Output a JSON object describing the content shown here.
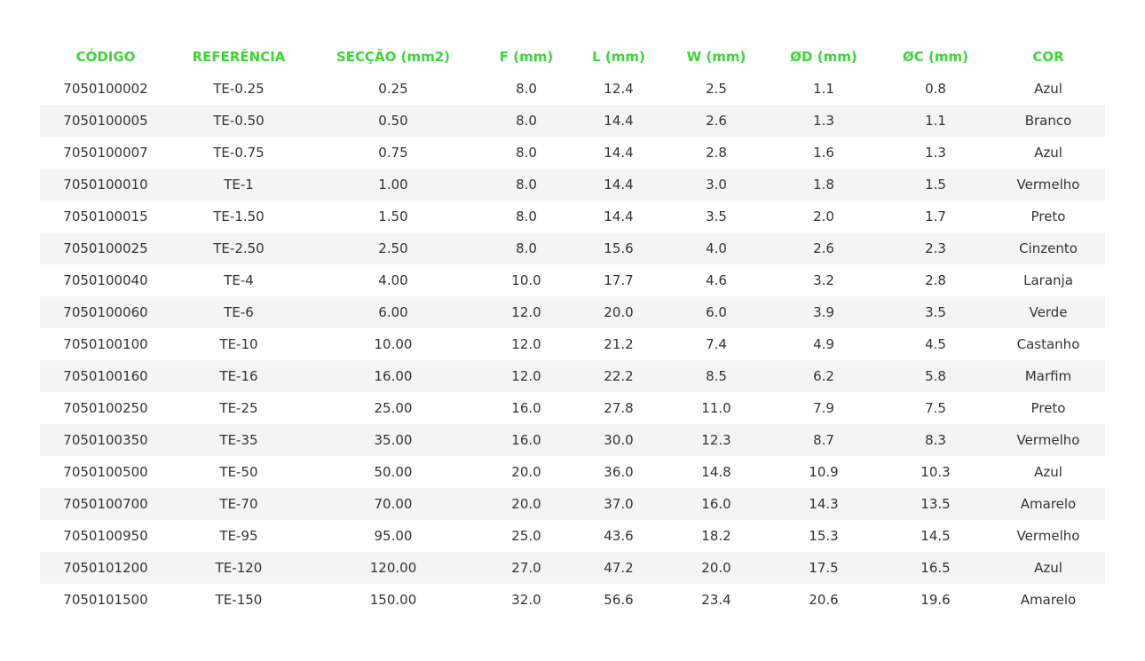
{
  "colors": {
    "accent": "#3fd43a",
    "text": "#333333",
    "row_alt": "#f4f4f4"
  },
  "table": {
    "headers": [
      "CÓDIGO",
      "REFERÊNCIA",
      "SECÇÃO (mm2)",
      "F (mm)",
      "L (mm)",
      "W (mm)",
      "ØD (mm)",
      "ØC (mm)",
      "COR"
    ],
    "rows": [
      [
        "7050100002",
        "TE-0.25",
        "0.25",
        "8.0",
        "12.4",
        "2.5",
        "1.1",
        "0.8",
        "Azul"
      ],
      [
        "7050100005",
        "TE-0.50",
        "0.50",
        "8.0",
        "14.4",
        "2.6",
        "1.3",
        "1.1",
        "Branco"
      ],
      [
        "7050100007",
        "TE-0.75",
        "0.75",
        "8.0",
        "14.4",
        "2.8",
        "1.6",
        "1.3",
        "Azul"
      ],
      [
        "7050100010",
        "TE-1",
        "1.00",
        "8.0",
        "14.4",
        "3.0",
        "1.8",
        "1.5",
        "Vermelho"
      ],
      [
        "7050100015",
        "TE-1.50",
        "1.50",
        "8.0",
        "14.4",
        "3.5",
        "2.0",
        "1.7",
        "Preto"
      ],
      [
        "7050100025",
        "TE-2.50",
        "2.50",
        "8.0",
        "15.6",
        "4.0",
        "2.6",
        "2.3",
        "Cinzento"
      ],
      [
        "7050100040",
        "TE-4",
        "4.00",
        "10.0",
        "17.7",
        "4.6",
        "3.2",
        "2.8",
        "Laranja"
      ],
      [
        "7050100060",
        "TE-6",
        "6.00",
        "12.0",
        "20.0",
        "6.0",
        "3.9",
        "3.5",
        "Verde"
      ],
      [
        "7050100100",
        "TE-10",
        "10.00",
        "12.0",
        "21.2",
        "7.4",
        "4.9",
        "4.5",
        "Castanho"
      ],
      [
        "7050100160",
        "TE-16",
        "16.00",
        "12.0",
        "22.2",
        "8.5",
        "6.2",
        "5.8",
        "Marfim"
      ],
      [
        "7050100250",
        "TE-25",
        "25.00",
        "16.0",
        "27.8",
        "11.0",
        "7.9",
        "7.5",
        "Preto"
      ],
      [
        "7050100350",
        "TE-35",
        "35.00",
        "16.0",
        "30.0",
        "12.3",
        "8.7",
        "8.3",
        "Vermelho"
      ],
      [
        "7050100500",
        "TE-50",
        "50.00",
        "20.0",
        "36.0",
        "14.8",
        "10.9",
        "10.3",
        "Azul"
      ],
      [
        "7050100700",
        "TE-70",
        "70.00",
        "20.0",
        "37.0",
        "16.0",
        "14.3",
        "13.5",
        "Amarelo"
      ],
      [
        "7050100950",
        "TE-95",
        "95.00",
        "25.0",
        "43.6",
        "18.2",
        "15.3",
        "14.5",
        "Vermelho"
      ],
      [
        "7050101200",
        "TE-120",
        "120.00",
        "27.0",
        "47.2",
        "20.0",
        "17.5",
        "16.5",
        "Azul"
      ],
      [
        "7050101500",
        "TE-150",
        "150.00",
        "32.0",
        "56.6",
        "23.4",
        "20.6",
        "19.6",
        "Amarelo"
      ]
    ]
  }
}
